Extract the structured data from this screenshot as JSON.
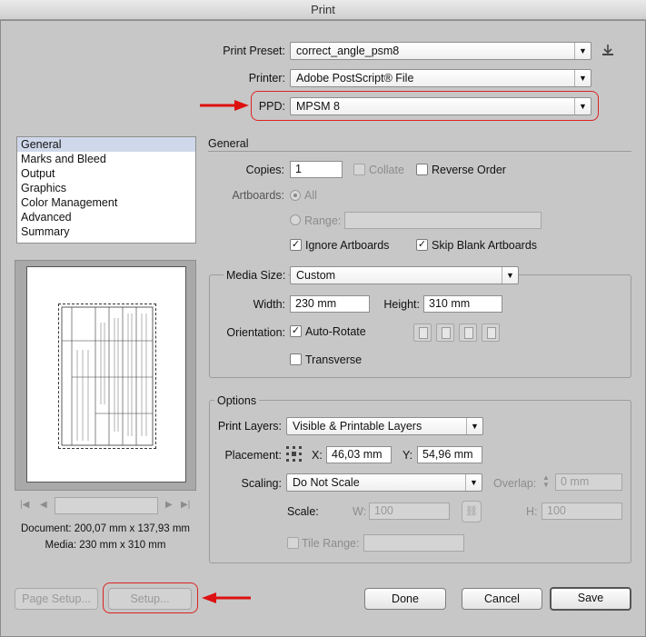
{
  "window": {
    "title": "Print"
  },
  "print_preset": {
    "label": "Print Preset:",
    "value": "correct_angle_psm8"
  },
  "printer": {
    "label": "Printer:",
    "value": "Adobe PostScript® File"
  },
  "ppd": {
    "label": "PPD:",
    "value": "MPSM 8"
  },
  "sidebar": {
    "items": [
      {
        "label": "General",
        "selected": true
      },
      {
        "label": "Marks and Bleed"
      },
      {
        "label": "Output"
      },
      {
        "label": "Graphics"
      },
      {
        "label": "Color Management"
      },
      {
        "label": "Advanced"
      },
      {
        "label": "Summary"
      }
    ]
  },
  "general": {
    "heading": "General",
    "copies_label": "Copies:",
    "copies_value": "1",
    "collate_label": "Collate",
    "reverse_order_label": "Reverse Order",
    "artboards_label": "Artboards:",
    "all_label": "All",
    "range_label": "Range:",
    "ignore_artboards_label": "Ignore Artboards",
    "skip_blank_label": "Skip Blank Artboards"
  },
  "media": {
    "label": "Media Size:",
    "value": "Custom",
    "width_label": "Width:",
    "width_value": "230 mm",
    "height_label": "Height:",
    "height_value": "310 mm",
    "orientation_label": "Orientation:",
    "auto_rotate_label": "Auto-Rotate",
    "transverse_label": "Transverse"
  },
  "options": {
    "heading": "Options",
    "print_layers_label": "Print Layers:",
    "print_layers_value": "Visible & Printable Layers",
    "placement_label": "Placement:",
    "x_label": "X:",
    "x_value": "46,03 mm",
    "y_label": "Y:",
    "y_value": "54,96 mm",
    "scaling_label": "Scaling:",
    "scaling_value": "Do Not Scale",
    "overlap_label": "Overlap:",
    "overlap_value": "0 mm",
    "scale_label": "Scale:",
    "w_label": "W:",
    "w_value": "100",
    "h_label": "H:",
    "h_value": "100",
    "tile_range_label": "Tile Range:"
  },
  "preview": {
    "document_text": "Document: 200,07 mm x 137,93 mm",
    "media_text": "Media: 230 mm x 310 mm"
  },
  "buttons": {
    "page_setup": "Page Setup...",
    "setup": "Setup...",
    "done": "Done",
    "cancel": "Cancel",
    "save": "Save"
  },
  "colors": {
    "annotation": "#dd1111",
    "selection": "#cfd8ea"
  }
}
